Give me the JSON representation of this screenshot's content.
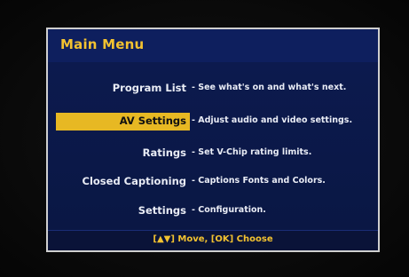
{
  "menu": {
    "title": "Main Menu",
    "items": [
      {
        "label": "Program List",
        "description": "- See what's on and what's next."
      },
      {
        "label": "AV Settings",
        "description": "- Adjust audio and video settings."
      },
      {
        "label": "Ratings",
        "description": "- Set V-Chip rating limits."
      },
      {
        "label": "Closed Captioning",
        "description": "- Captions Fonts and Colors."
      },
      {
        "label": "Settings",
        "description": "- Configuration."
      }
    ],
    "selected_index": 1,
    "footer_hint": "[▲▼] Move, [OK] Choose"
  },
  "colors": {
    "title": "#f2c230",
    "highlight": "#e7b823",
    "panel": "#0b1742",
    "text": "#e9ecf5"
  }
}
